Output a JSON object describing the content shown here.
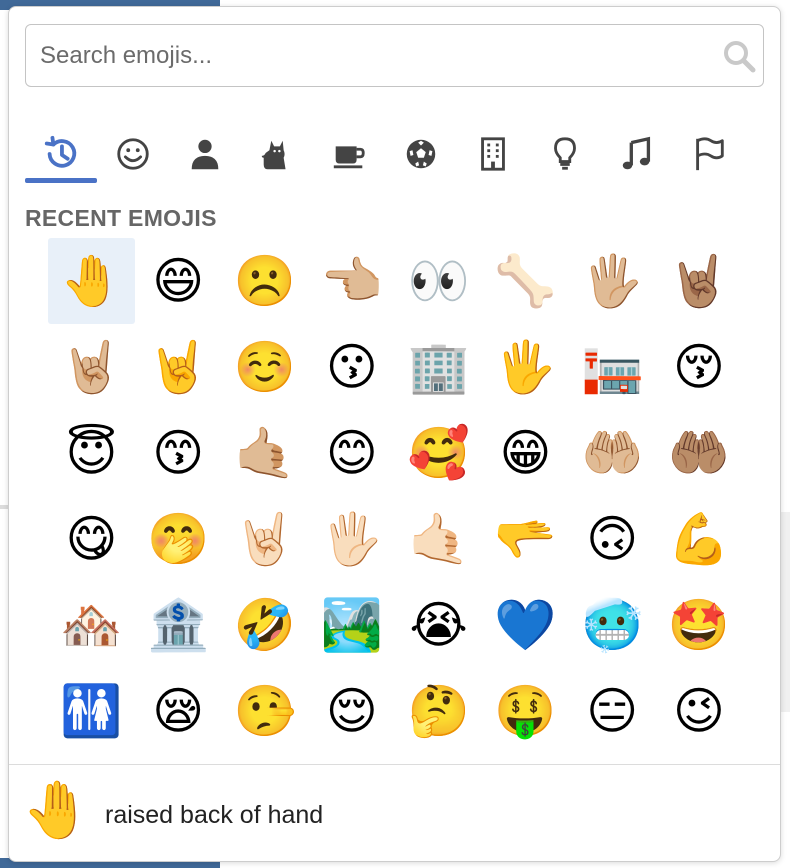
{
  "search": {
    "placeholder": "Search emojis..."
  },
  "categories": [
    {
      "icon": "clock-icon",
      "active": true
    },
    {
      "icon": "smiley-icon",
      "active": false
    },
    {
      "icon": "person-icon",
      "active": false
    },
    {
      "icon": "cat-icon",
      "active": false
    },
    {
      "icon": "coffee-icon",
      "active": false
    },
    {
      "icon": "soccer-ball-icon",
      "active": false
    },
    {
      "icon": "building-icon",
      "active": false
    },
    {
      "icon": "lightbulb-icon",
      "active": false
    },
    {
      "icon": "music-note-icon",
      "active": false
    },
    {
      "icon": "flag-icon",
      "active": false
    }
  ],
  "section_title": "RECENT EMOJIS",
  "emojis": [
    "🤚",
    "😄",
    "☹️",
    "👈🏼",
    "👀",
    "🦴",
    "🖐🏼",
    "🤘🏽",
    "🤘🏼",
    "🤘",
    "☺️",
    "😗",
    "🏢",
    "🖐️",
    "🏣",
    "😚",
    "😇",
    "😙",
    "🤙🏼",
    "😊",
    "🥰",
    "😁",
    "🤲🏼",
    "🤲🏽",
    "😋",
    "🤭",
    "🤘🏻",
    "🖐🏻",
    "🤙🏻",
    "🫳",
    "🙃",
    "💪",
    "🏘️",
    "🏦",
    "🤣",
    "🏞️",
    "😭",
    "💙",
    "🥶",
    "🤩",
    "🚻",
    "😪",
    "🤥",
    "😌",
    "🤔",
    "🤑",
    "😑",
    "😉"
  ],
  "selected_index": 0,
  "preview": {
    "emoji": "🤚",
    "name": "raised back of hand"
  },
  "accent_color": "#4a72c6"
}
